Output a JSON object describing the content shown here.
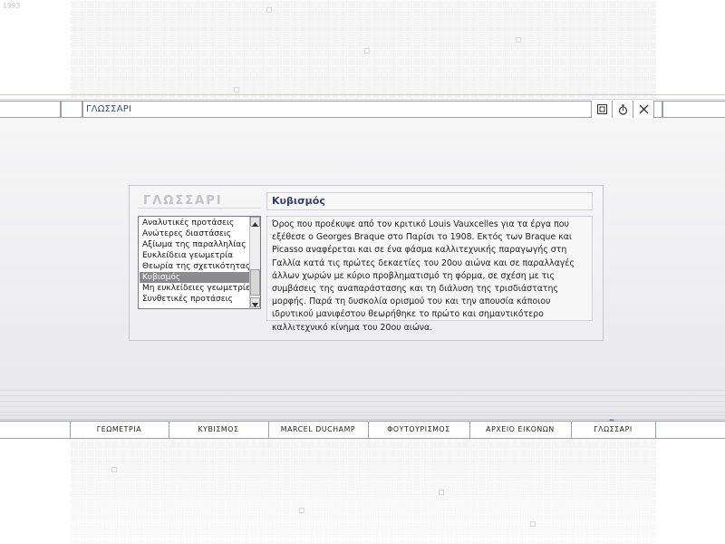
{
  "corner_label": "1993",
  "window": {
    "title": "ΓΛΩΣΣΑΡΙ",
    "buttons": [
      {
        "name": "frame",
        "icon": "frame-icon"
      },
      {
        "name": "timer",
        "icon": "stopwatch-icon"
      },
      {
        "name": "close",
        "icon": "close-icon"
      }
    ]
  },
  "glossary": {
    "heading": "ΓΛΩΣΣΑΡΙ",
    "terms": [
      "Αναλυτικές προτάσεις",
      "Ανώτερες διαστάσεις",
      "Αξίωμα της παραλληλίας",
      "Ευκλείδεια γεωμετρία",
      "Θεωρία της σχετικότητας",
      "Κυβισμός",
      "Μη ευκλείδειες γεωμετρίες",
      "Συνθετικές προτάσεις"
    ],
    "selected_index": 5,
    "selected_term": "Κυβισμός",
    "definition": "Όρος που προέκυψε από τον κριτικό Louis Vauxcelles για τα έργα που εξέθεσε ο Georges Braque στο Παρίσι το 1908. Εκτός των Braque και Picasso αναφέρεται και σε ένα φάσμα καλλιτεχνικής παραγωγής στη Γαλλία κατά τις πρώτες δεκαετίες του 20ου αιώνα και σε παραλλαγές άλλων χωρών με κύριο προβληματισμό τη φόρμα, σε σχέση με τις συμβάσεις της αναπαράστασης και τη διάλυση της τρισδιάστατης μορφής. Παρά τη δυσκολία ορισμού του και την απουσία κάποιου ιδρυτικού μανιφέστου θεωρήθηκε το πρώτο και σημαντικότερο καλλιτεχνικό κίνημα του 20ου αιώνα."
  },
  "nav": {
    "items": [
      "ΓΕΩΜΕΤΡΙΑ",
      "ΚΥΒΙΣΜΟΣ",
      "MARCEL DUCHAMP",
      "ΦΟΥΤΟΥΡΙΣΜΟΣ",
      "ΑΡΧΕΙΟ ΕΙΚΟΝΩΝ",
      "ΓΛΩΣΣΑΡΙ"
    ],
    "active_index": 5
  },
  "colors": {
    "title_text": "#3a4a8a",
    "frame_line": "#9aa0b0",
    "selection": "#8c8c90"
  }
}
